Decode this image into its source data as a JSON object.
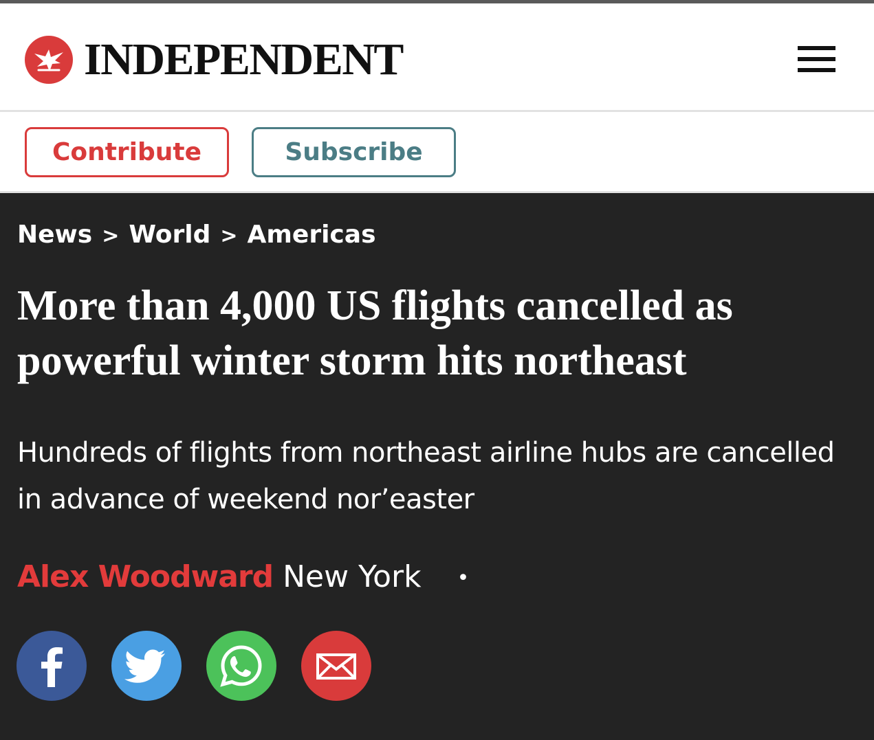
{
  "header": {
    "brand": "INDEPENDENT",
    "logo_icon": "eagle-icon",
    "menu_icon": "hamburger-menu-icon"
  },
  "actions": {
    "contribute_label": "Contribute",
    "subscribe_label": "Subscribe"
  },
  "breadcrumb": {
    "items": [
      "News",
      "World",
      "Americas"
    ],
    "separator": ">"
  },
  "article": {
    "headline": "More than 4,000 US flights cancelled as powerful winter storm hits northeast",
    "standfirst": "Hundreds of flights from northeast airline hubs are cancelled in advance of weekend nor’easter",
    "author": "Alex Woodward",
    "location": "New York",
    "byline_separator": "•"
  },
  "share": {
    "buttons": [
      {
        "network": "facebook",
        "icon": "facebook-icon",
        "color": "#3b5998"
      },
      {
        "network": "twitter",
        "icon": "twitter-icon",
        "color": "#4a9fe3"
      },
      {
        "network": "whatsapp",
        "icon": "whatsapp-icon",
        "color": "#4cc25a"
      },
      {
        "network": "email",
        "icon": "email-icon",
        "color": "#d93b3b"
      }
    ]
  },
  "colors": {
    "brand_red": "#d93b3b",
    "subscribe_teal": "#4b7d85",
    "article_background": "#232323",
    "author_red": "#e23b3b"
  }
}
